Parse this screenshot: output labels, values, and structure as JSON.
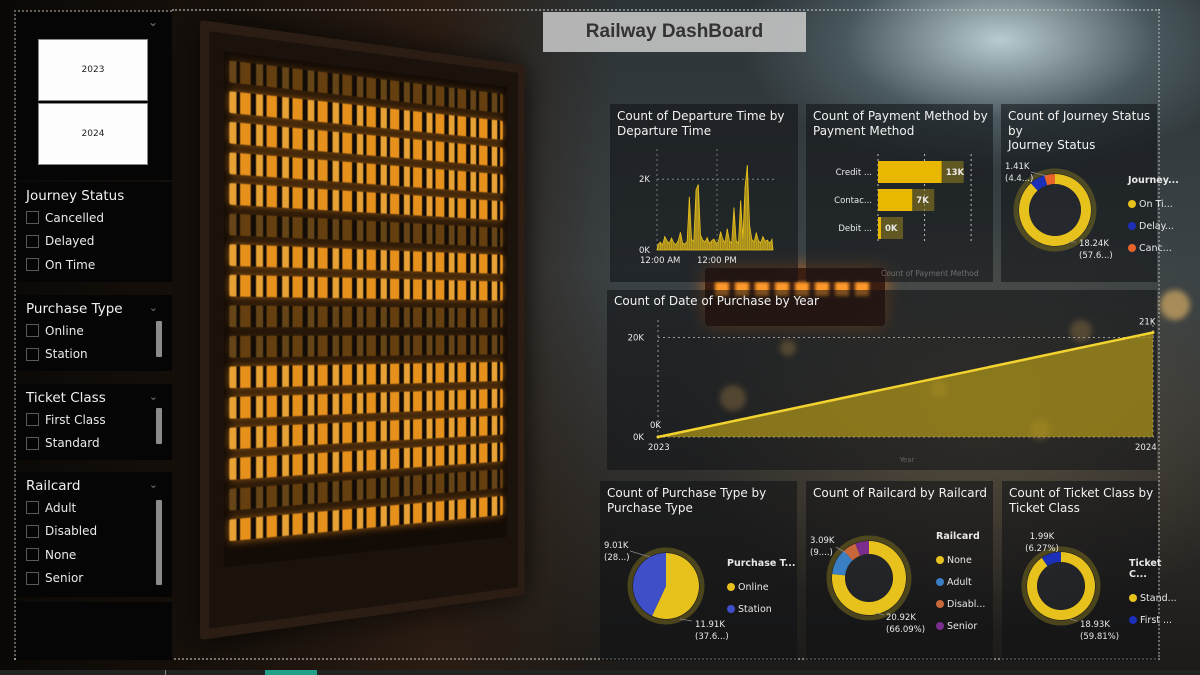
{
  "dashboard": {
    "title": "Railway DashBoard",
    "accent_color": "#E8C21C"
  },
  "slicers": {
    "year": {
      "options": [
        "2023",
        "2024"
      ]
    },
    "journey_status": {
      "title": "Journey Status",
      "options": [
        "Cancelled",
        "Delayed",
        "On Time"
      ]
    },
    "purchase_type": {
      "title": "Purchase Type",
      "options": [
        "Online",
        "Station"
      ]
    },
    "ticket_class": {
      "title": "Ticket Class",
      "options": [
        "First Class",
        "Standard"
      ]
    },
    "railcard": {
      "title": "Railcard",
      "options": [
        "Adult",
        "Disabled",
        "None",
        "Senior"
      ]
    }
  },
  "icons": {
    "chevron": "chevron-down-icon",
    "checkbox": "checkbox-icon"
  },
  "chart_data": [
    {
      "id": "departure",
      "type": "area",
      "title": "Count of Departure Time by Departure Time",
      "title_lines": [
        "Count of Departure Time by",
        "Departure Time"
      ],
      "xlabel": "",
      "ylabel": "",
      "x_ticks": [
        "12:00 AM",
        "12:00 PM"
      ],
      "y_ticks": [
        "0K",
        "2K"
      ],
      "ylim": [
        0,
        2600
      ],
      "grid": true,
      "values": [
        160,
        220,
        140,
        380,
        260,
        180,
        340,
        200,
        150,
        260,
        500,
        190,
        170,
        240,
        1500,
        300,
        250,
        1700,
        1850,
        420,
        280,
        220,
        350,
        180,
        260,
        310,
        190,
        230,
        520,
        300,
        210,
        600,
        250,
        200,
        1200,
        260,
        190,
        1400,
        320,
        1800,
        2400,
        700,
        300,
        230,
        480,
        260,
        200,
        380,
        240,
        280,
        180,
        300
      ]
    },
    {
      "id": "payment",
      "type": "bar",
      "orientation": "horizontal",
      "title": "Count of Payment Method by Payment Method",
      "title_lines": [
        "Count of Payment Method by",
        "Payment Method"
      ],
      "categories": [
        "Credit ...",
        "Contac...",
        "Debit ..."
      ],
      "values": [
        13000,
        7000,
        300
      ],
      "data_labels": [
        "13K",
        "7K",
        "0K"
      ],
      "xlabel": "Count of Payment Method",
      "xlim": [
        0,
        20000
      ],
      "color": "#E8B800"
    },
    {
      "id": "journey_status",
      "type": "pie",
      "donut": true,
      "title": "Count of Journey Status by Journey Status",
      "title_lines": [
        "Count of Journey Status by",
        "Journey Status"
      ],
      "legend_title": "Journey...",
      "legend_position": "right",
      "slices": [
        {
          "label": "On Ti...",
          "value": 18240,
          "color": "#E8C21C"
        },
        {
          "label": "Delay...",
          "value": 1410,
          "color": "#1B2FB8"
        },
        {
          "label": "Canc...",
          "value": 1000,
          "color": "#E8632A"
        }
      ],
      "annotations": [
        {
          "text": [
            "1.41K",
            "(4.4...)"
          ],
          "position": "top-left"
        },
        {
          "text": [
            "18.24K",
            "(57.6...)"
          ],
          "position": "bottom-right"
        }
      ]
    },
    {
      "id": "purchase_year",
      "type": "area",
      "title": "Count of Date of Purchase by Year",
      "x": [
        "2023",
        "2024"
      ],
      "values": [
        0,
        21000
      ],
      "data_labels": [
        "0K",
        "21K"
      ],
      "y_ticks": [
        "0K",
        "20K"
      ],
      "ylim": [
        0,
        22500
      ],
      "xlabel": "Year",
      "grid": true
    },
    {
      "id": "purchase_type",
      "type": "pie",
      "donut": false,
      "title": "Count of Purchase Type by Purchase Type",
      "title_lines": [
        "Count of Purchase Type by",
        "Purchase Type"
      ],
      "legend_title": "Purchase T...",
      "legend_position": "right",
      "slices": [
        {
          "label": "Online",
          "value": 11910,
          "color": "#E8C21C"
        },
        {
          "label": "Station",
          "value": 9010,
          "color": "#3F4FC8"
        }
      ],
      "annotations": [
        {
          "text": [
            "9.01K",
            "(28...)"
          ],
          "position": "top-left"
        },
        {
          "text": [
            "11.91K",
            "(37.6...)"
          ],
          "position": "bottom-right"
        }
      ]
    },
    {
      "id": "railcard",
      "type": "pie",
      "donut": true,
      "title": "Count of Railcard by Railcard",
      "title_lines": [
        "Count of Railcard by Railcard"
      ],
      "legend_title": "Railcard",
      "legend_position": "right",
      "slices": [
        {
          "label": "None",
          "value": 20920,
          "color": "#E8C21C"
        },
        {
          "label": "Adult",
          "value": 3090,
          "color": "#3A7FC4"
        },
        {
          "label": "Disabl...",
          "value": 1600,
          "color": "#C8683A"
        },
        {
          "label": "Senior",
          "value": 1650,
          "color": "#7A2D8C"
        }
      ],
      "annotations": [
        {
          "text": [
            "3.09K",
            "(9....)"
          ],
          "position": "top-left"
        },
        {
          "text": [
            "20.92K",
            "(66.09%)"
          ],
          "position": "bottom-right"
        }
      ]
    },
    {
      "id": "ticket_class",
      "type": "pie",
      "donut": true,
      "title": "Count of Ticket Class by Ticket Class",
      "title_lines": [
        "Count of Ticket Class by",
        "Ticket Class"
      ],
      "legend_title": "Ticket C...",
      "legend_position": "right",
      "slices": [
        {
          "label": "Stand...",
          "value": 18930,
          "color": "#E8C21C"
        },
        {
          "label": "First ...",
          "value": 1990,
          "color": "#1B2FB8"
        }
      ],
      "annotations": [
        {
          "text": [
            "1.99K",
            "(6.27%)"
          ],
          "position": "top-left"
        },
        {
          "text": [
            "18.93K",
            "(59.81%)"
          ],
          "position": "bottom-right"
        }
      ]
    }
  ]
}
